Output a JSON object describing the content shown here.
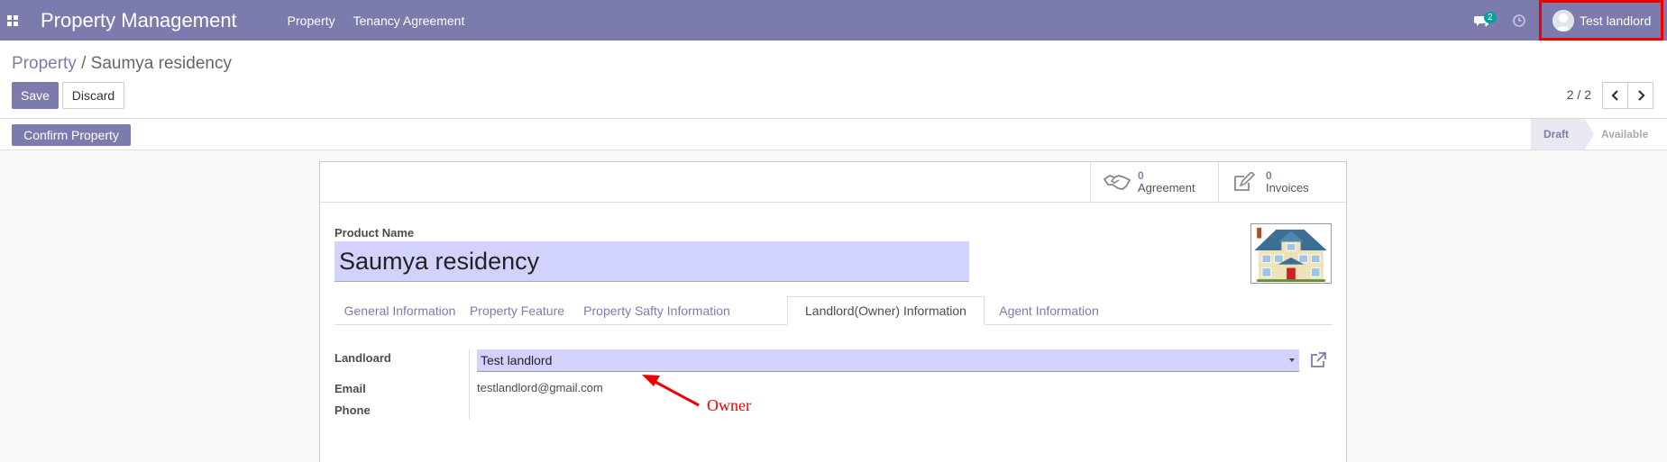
{
  "navbar": {
    "app_title": "Property Management",
    "menus": [
      "Property",
      "Tenancy Agreement"
    ],
    "chat_count": "2",
    "user_name": "Test landlord",
    "icons": [
      "apps-icon",
      "chat-icon",
      "clock-icon",
      "avatar"
    ],
    "color": "#7c7bad"
  },
  "breadcrumb": {
    "parent": "Property",
    "separator": "/",
    "current": "Saumya residency"
  },
  "buttons": {
    "save": "Save",
    "discard": "Discard",
    "confirm": "Confirm Property"
  },
  "pager": {
    "value": "2 / 2"
  },
  "statusbar": {
    "stages": [
      "Draft",
      "Available"
    ],
    "active": "Draft"
  },
  "smart_buttons": [
    {
      "count": "0",
      "label": "Agreement",
      "icon": "handshake-icon"
    },
    {
      "count": "0",
      "label": "Invoices",
      "icon": "edit-icon"
    }
  ],
  "form": {
    "name_label": "Product Name",
    "name_value": "Saumya residency",
    "tabs": [
      "General Information",
      "Property Feature",
      "Property Safty Information",
      "Landlord(Owner) Information",
      "Agent Information"
    ],
    "active_tab": "Landlord(Owner) Information",
    "landlord_label": "Landloard",
    "landlord_value": "Test landlord",
    "email_label": "Email",
    "email_value": "testlandlord@gmail.com",
    "phone_label": "Phone"
  },
  "annotation": {
    "text": "Owner",
    "color": "#e00000"
  }
}
